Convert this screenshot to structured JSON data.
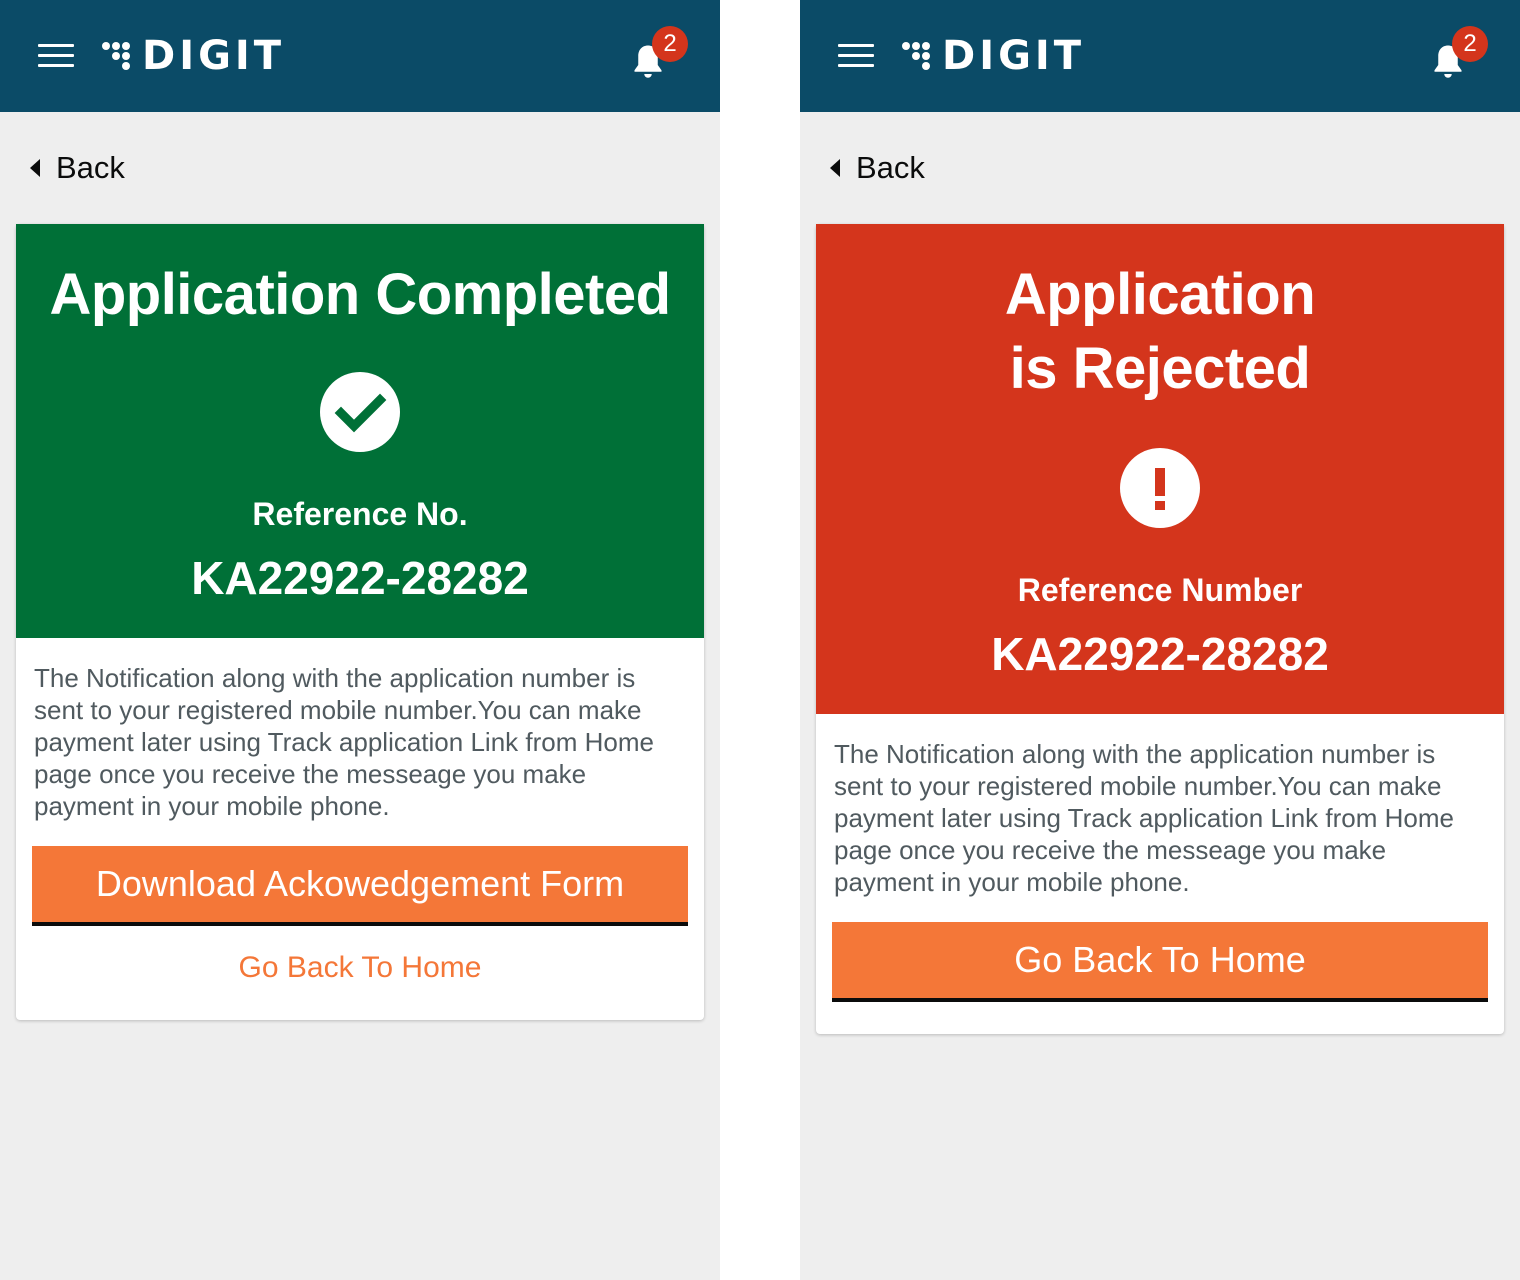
{
  "app": {
    "logo_text": "DIGIT",
    "notification_count": "2",
    "back_label": "Back",
    "colors": {
      "header": "#0b4b67",
      "success": "#007037",
      "error": "#d4351c",
      "accent": "#f47738",
      "badge": "#d4351c",
      "background": "#eeeeee"
    }
  },
  "completed_screen": {
    "title": "Application Completed",
    "status_icon": "check-circle-icon",
    "reference_label": "Reference No.",
    "reference_number": "KA22922-28282",
    "message": "The Notification along with the application number is sent to your registered mobile number.You can make payment later using Track application Link from  Home page once you receive the messeage you make payment in your mobile phone.",
    "primary_button": "Download Ackowedgement Form",
    "home_link": "Go Back To Home"
  },
  "rejected_screen": {
    "title_line1": "Application",
    "title_line2": "is Rejected",
    "status_icon": "exclamation-circle-icon",
    "reference_label": "Reference Number",
    "reference_number": "KA22922-28282",
    "message": "The Notification along with the application number is sent to your registered mobile number.You can make payment later using Track application Link from  Home page once you receive the messeage you make payment in your mobile phone.",
    "primary_button": "Go Back To Home"
  }
}
